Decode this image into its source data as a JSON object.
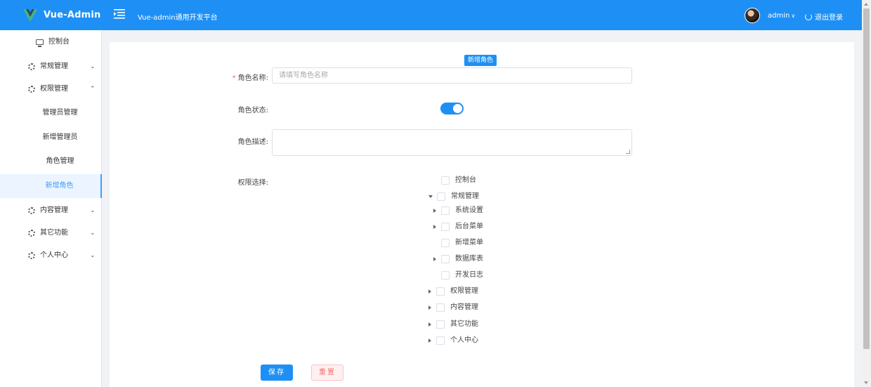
{
  "header": {
    "brand": "Vue-Admin",
    "app_title": "Vue-admin通用开发平台",
    "user_name": "admin",
    "user_chevron": "∨",
    "logout_label": "退出登录",
    "accent_color": "#1e90f5"
  },
  "sidebar": {
    "dashboard": "控制台",
    "items": [
      {
        "label": "常规管理",
        "arrow": "⌄"
      },
      {
        "label": "权限管理",
        "arrow": "⌃"
      },
      {
        "label": "内容管理",
        "arrow": "⌄"
      },
      {
        "label": "其它功能",
        "arrow": "⌄"
      },
      {
        "label": "个人中心",
        "arrow": "⌄"
      }
    ],
    "sub_items": [
      "管理员管理",
      "新增管理员",
      "角色管理",
      "新增角色"
    ],
    "active_sub": "新增角色"
  },
  "form": {
    "tag": "新增角色",
    "name_label": "角色名称:",
    "name_required": "*",
    "name_placeholder": "请填写角色名称",
    "status_label": "角色状态:",
    "status_on": true,
    "desc_label": "角色描述:",
    "perm_label": "权限选择:"
  },
  "tree": [
    {
      "label": "控制台",
      "caret": "none"
    },
    {
      "label": "常规管理",
      "caret": "down"
    },
    {
      "label": "系统设置",
      "caret": "right"
    },
    {
      "label": "后台菜单",
      "caret": "right"
    },
    {
      "label": "新增菜单",
      "caret": "none"
    },
    {
      "label": "数据库表",
      "caret": "right"
    },
    {
      "label": "开发日志",
      "caret": "none"
    },
    {
      "label": "权限管理",
      "caret": "right"
    },
    {
      "label": "内容管理",
      "caret": "right"
    },
    {
      "label": "其它功能",
      "caret": "right"
    },
    {
      "label": "个人中心",
      "caret": "right"
    }
  ],
  "buttons": {
    "save": "保存",
    "reset": "重置"
  }
}
